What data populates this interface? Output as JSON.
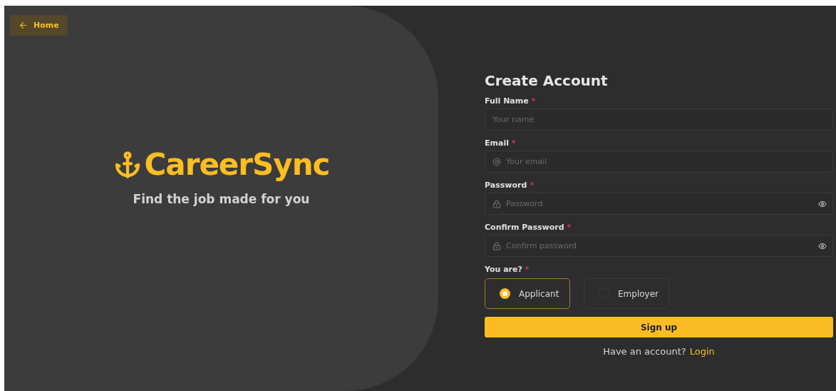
{
  "home_button": {
    "label": "Home"
  },
  "brand": {
    "name": "CareerSync",
    "tagline": "Find the job made for you"
  },
  "form": {
    "title": "Create Account",
    "fields": [
      {
        "kind": "text",
        "label": "Full Name",
        "required_mark": "*",
        "placeholder": "Your name"
      },
      {
        "kind": "email",
        "label": "Email",
        "required_mark": "*",
        "placeholder": "Your email"
      },
      {
        "kind": "password",
        "label": "Password",
        "required_mark": "*",
        "placeholder": "Password"
      },
      {
        "kind": "password",
        "label": "Confirm Password",
        "required_mark": "*",
        "placeholder": "Confirm password"
      }
    ],
    "role": {
      "label": "You are?",
      "required_mark": "*",
      "options": [
        {
          "label": "Applicant",
          "selected": true
        },
        {
          "label": "Employer",
          "selected": false
        }
      ]
    },
    "submit": "Sign up",
    "footer": {
      "text": "Have an account?",
      "link": "Login"
    }
  }
}
